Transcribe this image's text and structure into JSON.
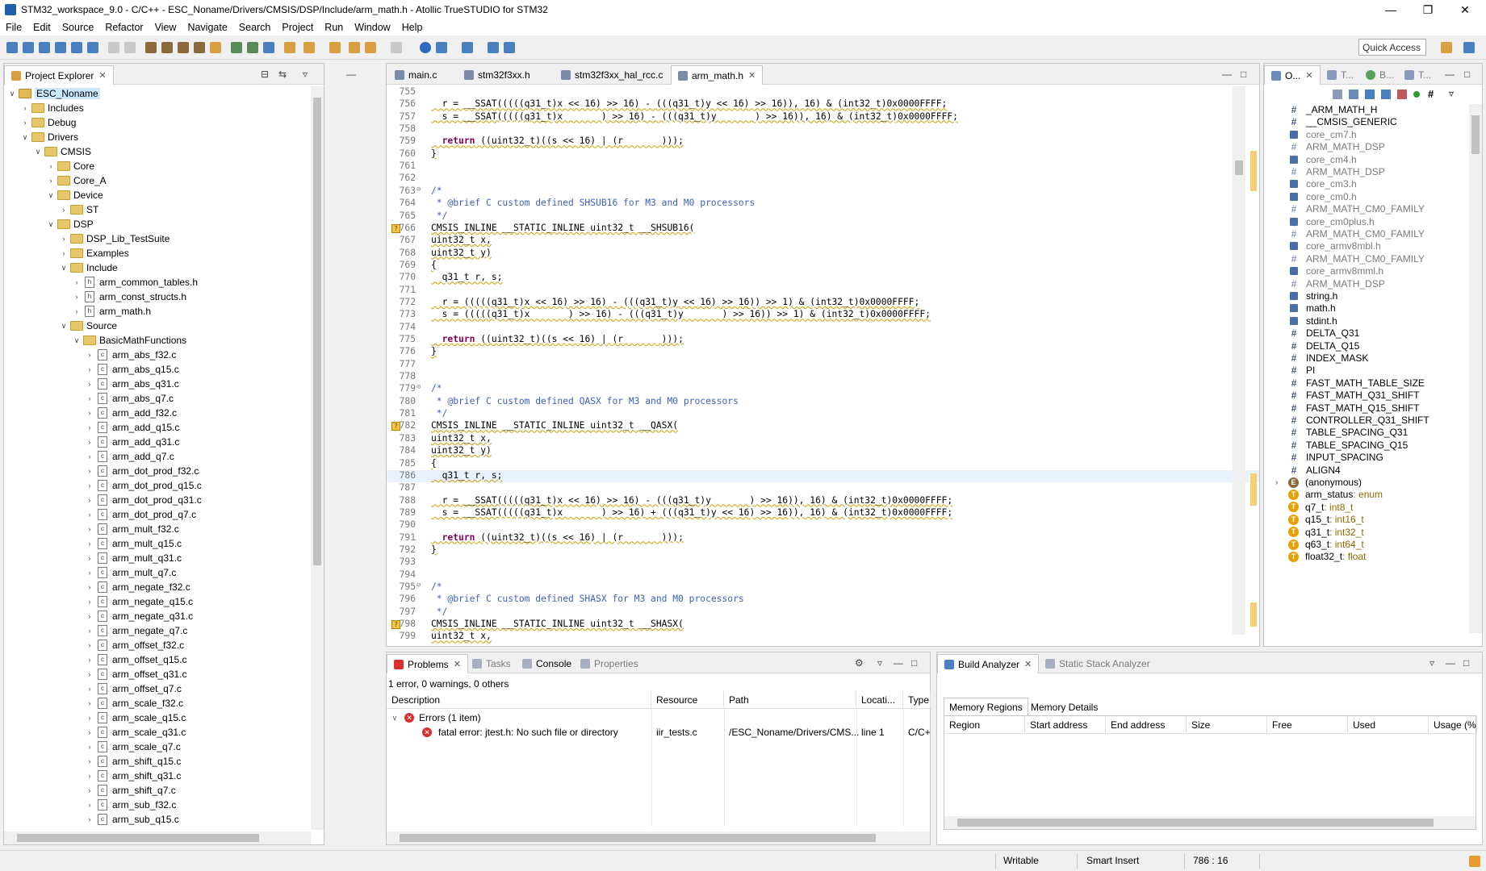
{
  "window": {
    "title": "STM32_workspace_9.0 - C/C++ - ESC_Noname/Drivers/CMSIS/DSP/Include/arm_math.h - Atollic TrueSTUDIO for STM32"
  },
  "menu": [
    "File",
    "Edit",
    "Source",
    "Refactor",
    "View",
    "Navigate",
    "Search",
    "Project",
    "Run",
    "Window",
    "Help"
  ],
  "quick_access": "Quick Access",
  "project_explorer": {
    "tab": "Project Explorer",
    "tree": [
      {
        "label": "ESC_Noname",
        "indent": 0,
        "arrow": "v",
        "icon": "project"
      },
      {
        "label": "Includes",
        "indent": 1,
        "arrow": ">",
        "icon": "folder"
      },
      {
        "label": "Debug",
        "indent": 1,
        "arrow": ">",
        "icon": "folder"
      },
      {
        "label": "Drivers",
        "indent": 1,
        "arrow": "v",
        "icon": "folder"
      },
      {
        "label": "CMSIS",
        "indent": 2,
        "arrow": "v",
        "icon": "folder"
      },
      {
        "label": "Core",
        "indent": 3,
        "arrow": ">",
        "icon": "folder"
      },
      {
        "label": "Core_A",
        "indent": 3,
        "arrow": ">",
        "icon": "folder"
      },
      {
        "label": "Device",
        "indent": 3,
        "arrow": "v",
        "icon": "folder"
      },
      {
        "label": "ST",
        "indent": 4,
        "arrow": ">",
        "icon": "folder"
      },
      {
        "label": "DSP",
        "indent": 3,
        "arrow": "v",
        "icon": "folder"
      },
      {
        "label": "DSP_Lib_TestSuite",
        "indent": 4,
        "arrow": ">",
        "icon": "folder"
      },
      {
        "label": "Examples",
        "indent": 4,
        "arrow": ">",
        "icon": "folder"
      },
      {
        "label": "Include",
        "indent": 4,
        "arrow": "v",
        "icon": "folder"
      },
      {
        "label": "arm_common_tables.h",
        "indent": 5,
        "arrow": ">",
        "icon": "h"
      },
      {
        "label": "arm_const_structs.h",
        "indent": 5,
        "arrow": ">",
        "icon": "h"
      },
      {
        "label": "arm_math.h",
        "indent": 5,
        "arrow": ">",
        "icon": "h"
      },
      {
        "label": "Source",
        "indent": 4,
        "arrow": "v",
        "icon": "folder"
      },
      {
        "label": "BasicMathFunctions",
        "indent": 5,
        "arrow": "v",
        "icon": "folder"
      },
      {
        "label": "arm_abs_f32.c",
        "indent": 6,
        "arrow": ">",
        "icon": "c"
      },
      {
        "label": "arm_abs_q15.c",
        "indent": 6,
        "arrow": ">",
        "icon": "c"
      },
      {
        "label": "arm_abs_q31.c",
        "indent": 6,
        "arrow": ">",
        "icon": "c"
      },
      {
        "label": "arm_abs_q7.c",
        "indent": 6,
        "arrow": ">",
        "icon": "c"
      },
      {
        "label": "arm_add_f32.c",
        "indent": 6,
        "arrow": ">",
        "icon": "c"
      },
      {
        "label": "arm_add_q15.c",
        "indent": 6,
        "arrow": ">",
        "icon": "c"
      },
      {
        "label": "arm_add_q31.c",
        "indent": 6,
        "arrow": ">",
        "icon": "c"
      },
      {
        "label": "arm_add_q7.c",
        "indent": 6,
        "arrow": ">",
        "icon": "c"
      },
      {
        "label": "arm_dot_prod_f32.c",
        "indent": 6,
        "arrow": ">",
        "icon": "c"
      },
      {
        "label": "arm_dot_prod_q15.c",
        "indent": 6,
        "arrow": ">",
        "icon": "c"
      },
      {
        "label": "arm_dot_prod_q31.c",
        "indent": 6,
        "arrow": ">",
        "icon": "c"
      },
      {
        "label": "arm_dot_prod_q7.c",
        "indent": 6,
        "arrow": ">",
        "icon": "c"
      },
      {
        "label": "arm_mult_f32.c",
        "indent": 6,
        "arrow": ">",
        "icon": "c"
      },
      {
        "label": "arm_mult_q15.c",
        "indent": 6,
        "arrow": ">",
        "icon": "c"
      },
      {
        "label": "arm_mult_q31.c",
        "indent": 6,
        "arrow": ">",
        "icon": "c"
      },
      {
        "label": "arm_mult_q7.c",
        "indent": 6,
        "arrow": ">",
        "icon": "c"
      },
      {
        "label": "arm_negate_f32.c",
        "indent": 6,
        "arrow": ">",
        "icon": "c"
      },
      {
        "label": "arm_negate_q15.c",
        "indent": 6,
        "arrow": ">",
        "icon": "c"
      },
      {
        "label": "arm_negate_q31.c",
        "indent": 6,
        "arrow": ">",
        "icon": "c"
      },
      {
        "label": "arm_negate_q7.c",
        "indent": 6,
        "arrow": ">",
        "icon": "c"
      },
      {
        "label": "arm_offset_f32.c",
        "indent": 6,
        "arrow": ">",
        "icon": "c"
      },
      {
        "label": "arm_offset_q15.c",
        "indent": 6,
        "arrow": ">",
        "icon": "c"
      },
      {
        "label": "arm_offset_q31.c",
        "indent": 6,
        "arrow": ">",
        "icon": "c"
      },
      {
        "label": "arm_offset_q7.c",
        "indent": 6,
        "arrow": ">",
        "icon": "c"
      },
      {
        "label": "arm_scale_f32.c",
        "indent": 6,
        "arrow": ">",
        "icon": "c"
      },
      {
        "label": "arm_scale_q15.c",
        "indent": 6,
        "arrow": ">",
        "icon": "c"
      },
      {
        "label": "arm_scale_q31.c",
        "indent": 6,
        "arrow": ">",
        "icon": "c"
      },
      {
        "label": "arm_scale_q7.c",
        "indent": 6,
        "arrow": ">",
        "icon": "c"
      },
      {
        "label": "arm_shift_q15.c",
        "indent": 6,
        "arrow": ">",
        "icon": "c"
      },
      {
        "label": "arm_shift_q31.c",
        "indent": 6,
        "arrow": ">",
        "icon": "c"
      },
      {
        "label": "arm_shift_q7.c",
        "indent": 6,
        "arrow": ">",
        "icon": "c"
      },
      {
        "label": "arm_sub_f32.c",
        "indent": 6,
        "arrow": ">",
        "icon": "c"
      },
      {
        "label": "arm_sub_q15.c",
        "indent": 6,
        "arrow": ">",
        "icon": "c"
      }
    ]
  },
  "editor": {
    "tabs": [
      "main.c",
      "stm32f3xx.h",
      "stm32f3xx_hal_rcc.c",
      "arm_math.h"
    ],
    "active_tab": "arm_math.h",
    "lines": [
      {
        "n": "755",
        "t": ""
      },
      {
        "n": "756",
        "t": "  r = __SSAT(((((q31_t)x << 16) >> 16) - (((q31_t)y << 16) >> 16)), 16) & (int32_t)0x0000FFFF;",
        "sq": true
      },
      {
        "n": "757",
        "t": "  s = __SSAT(((((q31_t)x       ) >> 16) - (((q31_t)y       ) >> 16)), 16) & (int32_t)0x0000FFFF;",
        "sq": true
      },
      {
        "n": "758",
        "t": ""
      },
      {
        "n": "759",
        "t": "  return ((uint32_t)((s << 16) | (r       )));",
        "sq": true,
        "kw": "return"
      },
      {
        "n": "760",
        "t": "}",
        "sq": true
      },
      {
        "n": "761",
        "t": ""
      },
      {
        "n": "762",
        "t": ""
      },
      {
        "n": "763",
        "t": "/*",
        "cm": true,
        "fold": true
      },
      {
        "n": "764",
        "t": " * @brief C custom defined SHSUB16 for M3 and M0 processors",
        "cm": true
      },
      {
        "n": "765",
        "t": " */",
        "cm": true
      },
      {
        "n": "766",
        "t": "CMSIS_INLINE __STATIC_INLINE uint32_t __SHSUB16(",
        "sq": true,
        "warn": true
      },
      {
        "n": "767",
        "t": "uint32_t x,",
        "sq": true
      },
      {
        "n": "768",
        "t": "uint32_t y)",
        "sq": true
      },
      {
        "n": "769",
        "t": "{",
        "sq": true
      },
      {
        "n": "770",
        "t": "  q31_t r, s;",
        "sq": true
      },
      {
        "n": "771",
        "t": ""
      },
      {
        "n": "772",
        "t": "  r = (((((q31_t)x << 16) >> 16) - (((q31_t)y << 16) >> 16)) >> 1) & (int32_t)0x0000FFFF;",
        "sq": true
      },
      {
        "n": "773",
        "t": "  s = (((((q31_t)x       ) >> 16) - (((q31_t)y       ) >> 16)) >> 1) & (int32_t)0x0000FFFF;",
        "sq": true
      },
      {
        "n": "774",
        "t": ""
      },
      {
        "n": "775",
        "t": "  return ((uint32_t)((s << 16) | (r       )));",
        "sq": true,
        "kw": "return"
      },
      {
        "n": "776",
        "t": "}",
        "sq": true
      },
      {
        "n": "777",
        "t": ""
      },
      {
        "n": "778",
        "t": ""
      },
      {
        "n": "779",
        "t": "/*",
        "cm": true,
        "fold": true
      },
      {
        "n": "780",
        "t": " * @brief C custom defined QASX for M3 and M0 processors",
        "cm": true
      },
      {
        "n": "781",
        "t": " */",
        "cm": true
      },
      {
        "n": "782",
        "t": "CMSIS_INLINE __STATIC_INLINE uint32_t __QASX(",
        "sq": true,
        "warn": true
      },
      {
        "n": "783",
        "t": "uint32_t x,",
        "sq": true
      },
      {
        "n": "784",
        "t": "uint32_t y)",
        "sq": true
      },
      {
        "n": "785",
        "t": "{",
        "sq": true
      },
      {
        "n": "786",
        "t": "  q31_t r, s;",
        "sq": true,
        "cursor": true
      },
      {
        "n": "787",
        "t": ""
      },
      {
        "n": "788",
        "t": "  r = __SSAT(((((q31_t)x << 16) >> 16) - (((q31_t)y       ) >> 16)), 16) & (int32_t)0x0000FFFF;",
        "sq": true
      },
      {
        "n": "789",
        "t": "  s = __SSAT(((((q31_t)x       ) >> 16) + (((q31_t)y << 16) >> 16)), 16) & (int32_t)0x0000FFFF;",
        "sq": true
      },
      {
        "n": "790",
        "t": ""
      },
      {
        "n": "791",
        "t": "  return ((uint32_t)((s << 16) | (r       )));",
        "sq": true,
        "kw": "return"
      },
      {
        "n": "792",
        "t": "}",
        "sq": true
      },
      {
        "n": "793",
        "t": ""
      },
      {
        "n": "794",
        "t": ""
      },
      {
        "n": "795",
        "t": "/*",
        "cm": true,
        "fold": true
      },
      {
        "n": "796",
        "t": " * @brief C custom defined SHASX for M3 and M0 processors",
        "cm": true
      },
      {
        "n": "797",
        "t": " */",
        "cm": true
      },
      {
        "n": "798",
        "t": "CMSIS_INLINE __STATIC_INLINE uint32_t __SHASX(",
        "sq": true,
        "warn": true
      },
      {
        "n": "799",
        "t": "uint32_t x,",
        "sq": true
      }
    ]
  },
  "outline": {
    "tabs": [
      "O...",
      "T...",
      "B...",
      "T..."
    ],
    "items": [
      {
        "label": "_ARM_MATH_H",
        "kind": "hash"
      },
      {
        "label": "__CMSIS_GENERIC",
        "kind": "hash"
      },
      {
        "label": "core_cm7.h",
        "kind": "inc",
        "gray": true
      },
      {
        "label": "ARM_MATH_DSP",
        "kind": "hash",
        "gray": true
      },
      {
        "label": "core_cm4.h",
        "kind": "inc",
        "gray": true
      },
      {
        "label": "ARM_MATH_DSP",
        "kind": "hash",
        "gray": true
      },
      {
        "label": "core_cm3.h",
        "kind": "inc",
        "gray": true
      },
      {
        "label": "core_cm0.h",
        "kind": "inc",
        "gray": true
      },
      {
        "label": "ARM_MATH_CM0_FAMILY",
        "kind": "hash",
        "gray": true
      },
      {
        "label": "core_cm0plus.h",
        "kind": "inc",
        "gray": true
      },
      {
        "label": "ARM_MATH_CM0_FAMILY",
        "kind": "hash",
        "gray": true
      },
      {
        "label": "core_armv8mbl.h",
        "kind": "inc",
        "gray": true
      },
      {
        "label": "ARM_MATH_CM0_FAMILY",
        "kind": "hash",
        "gray": true
      },
      {
        "label": "core_armv8mml.h",
        "kind": "inc",
        "gray": true
      },
      {
        "label": "ARM_MATH_DSP",
        "kind": "hash",
        "gray": true
      },
      {
        "label": "string.h",
        "kind": "inc"
      },
      {
        "label": "math.h",
        "kind": "inc"
      },
      {
        "label": "stdint.h",
        "kind": "inc"
      },
      {
        "label": "DELTA_Q31",
        "kind": "hash"
      },
      {
        "label": "DELTA_Q15",
        "kind": "hash"
      },
      {
        "label": "INDEX_MASK",
        "kind": "hash"
      },
      {
        "label": "PI",
        "kind": "hash"
      },
      {
        "label": "FAST_MATH_TABLE_SIZE",
        "kind": "hash"
      },
      {
        "label": "FAST_MATH_Q31_SHIFT",
        "kind": "hash"
      },
      {
        "label": "FAST_MATH_Q15_SHIFT",
        "kind": "hash"
      },
      {
        "label": "CONTROLLER_Q31_SHIFT",
        "kind": "hash"
      },
      {
        "label": "TABLE_SPACING_Q31",
        "kind": "hash"
      },
      {
        "label": "TABLE_SPACING_Q15",
        "kind": "hash"
      },
      {
        "label": "INPUT_SPACING",
        "kind": "hash"
      },
      {
        "label": "ALIGN4",
        "kind": "hash"
      },
      {
        "label": "(anonymous)",
        "kind": "enum",
        "arrow": true
      },
      {
        "label": "arm_status",
        "kind": "T",
        "type": " : enum"
      },
      {
        "label": "q7_t",
        "kind": "T",
        "type": " : int8_t"
      },
      {
        "label": "q15_t",
        "kind": "T",
        "type": " : int16_t"
      },
      {
        "label": "q31_t",
        "kind": "T",
        "type": " : int32_t"
      },
      {
        "label": "q63_t",
        "kind": "T",
        "type": " : int64_t"
      },
      {
        "label": "float32_t",
        "kind": "T",
        "type": " : float"
      }
    ]
  },
  "problems": {
    "tabs": [
      "Problems",
      "Tasks",
      "Console",
      "Properties"
    ],
    "summary": "1 error, 0 warnings, 0 others",
    "columns": [
      "Description",
      "Resource",
      "Path",
      "Locati...",
      "Type"
    ],
    "group": "Errors (1 item)",
    "error": {
      "description": "fatal error: jtest.h: No such file or directory",
      "resource": "iir_tests.c",
      "path": "/ESC_Noname/Drivers/CMS...",
      "location": "line 1",
      "type": "C/C+"
    }
  },
  "build_analyzer": {
    "tabs": [
      "Build Analyzer",
      "Static Stack Analyzer"
    ],
    "subtabs": [
      "Memory Regions",
      "Memory Details"
    ],
    "columns": [
      "Region",
      "Start address",
      "End address",
      "Size",
      "Free",
      "Used",
      "Usage (%"
    ]
  },
  "status": {
    "writable": "Writable",
    "insert": "Smart Insert",
    "position": "786 : 16"
  },
  "colors": {
    "accent": "#1f5fa8",
    "keyword": "#7f0055",
    "comment": "#3f5fbf",
    "error": "#d8302f",
    "warning": "#f5c542"
  }
}
